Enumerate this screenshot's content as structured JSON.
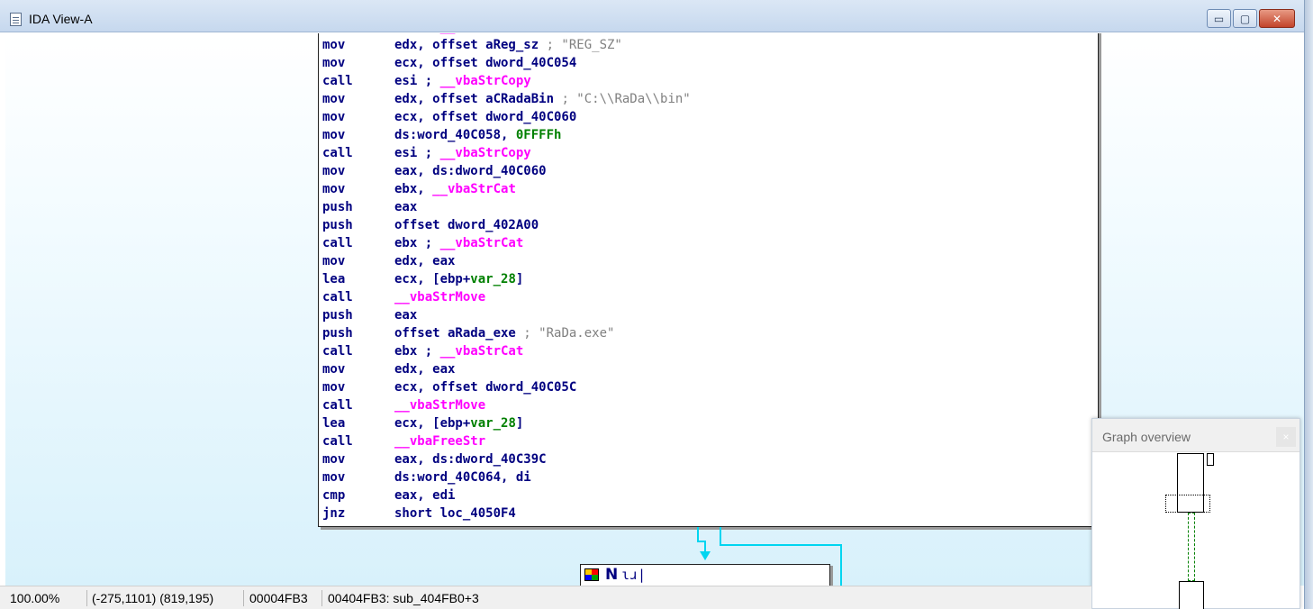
{
  "window": {
    "title": "IDA View-A",
    "buttons": {
      "minimize": "▭",
      "maximize": "▢",
      "close": "✕"
    }
  },
  "code": {
    "lines": [
      {
        "mn": "call",
        "parts": [
          [
            "r",
            "esi ; "
          ],
          [
            "k",
            "__vbaStrCopy"
          ]
        ]
      },
      {
        "mn": "mov",
        "parts": [
          [
            "r",
            "edx, offset aReg_sz "
          ],
          [
            "c",
            "; \"REG_SZ\""
          ]
        ]
      },
      {
        "mn": "mov",
        "parts": [
          [
            "r",
            "ecx, offset dword_40C054"
          ]
        ]
      },
      {
        "mn": "call",
        "parts": [
          [
            "r",
            "esi ; "
          ],
          [
            "k",
            "__vbaStrCopy"
          ]
        ]
      },
      {
        "mn": "mov",
        "parts": [
          [
            "r",
            "edx, offset aCRadaBin "
          ],
          [
            "c",
            "; \"C:\\\\RaDa\\\\bin\""
          ]
        ]
      },
      {
        "mn": "mov",
        "parts": [
          [
            "r",
            "ecx, offset dword_40C060"
          ]
        ]
      },
      {
        "mn": "mov",
        "parts": [
          [
            "r",
            "ds:word_40C058, "
          ],
          [
            "n",
            "0FFFFh"
          ]
        ]
      },
      {
        "mn": "call",
        "parts": [
          [
            "r",
            "esi ; "
          ],
          [
            "k",
            "__vbaStrCopy"
          ]
        ]
      },
      {
        "mn": "mov",
        "parts": [
          [
            "r",
            "eax, ds:dword_40C060"
          ]
        ]
      },
      {
        "mn": "mov",
        "parts": [
          [
            "r",
            "ebx, "
          ],
          [
            "k",
            "__vbaStrCat"
          ]
        ]
      },
      {
        "mn": "push",
        "parts": [
          [
            "r",
            "eax"
          ]
        ]
      },
      {
        "mn": "push",
        "parts": [
          [
            "r",
            "offset dword_402A00"
          ]
        ]
      },
      {
        "mn": "call",
        "parts": [
          [
            "r",
            "ebx ; "
          ],
          [
            "k",
            "__vbaStrCat"
          ]
        ]
      },
      {
        "mn": "mov",
        "parts": [
          [
            "r",
            "edx, eax"
          ]
        ]
      },
      {
        "mn": "lea",
        "parts": [
          [
            "r",
            "ecx, [ebp+"
          ],
          [
            "n",
            "var_28"
          ],
          [
            "r",
            "]"
          ]
        ]
      },
      {
        "mn": "call",
        "parts": [
          [
            "k",
            "__vbaStrMove"
          ]
        ]
      },
      {
        "mn": "push",
        "parts": [
          [
            "r",
            "eax"
          ]
        ]
      },
      {
        "mn": "push",
        "parts": [
          [
            "r",
            "offset aRada_exe "
          ],
          [
            "c",
            "; \"RaDa.exe\""
          ]
        ]
      },
      {
        "mn": "call",
        "parts": [
          [
            "r",
            "ebx ; "
          ],
          [
            "k",
            "__vbaStrCat"
          ]
        ]
      },
      {
        "mn": "mov",
        "parts": [
          [
            "r",
            "edx, eax"
          ]
        ]
      },
      {
        "mn": "mov",
        "parts": [
          [
            "r",
            "ecx, offset dword_40C05C"
          ]
        ]
      },
      {
        "mn": "call",
        "parts": [
          [
            "k",
            "__vbaStrMove"
          ]
        ]
      },
      {
        "mn": "lea",
        "parts": [
          [
            "r",
            "ecx, [ebp+"
          ],
          [
            "n",
            "var_28"
          ],
          [
            "r",
            "]"
          ]
        ]
      },
      {
        "mn": "call",
        "parts": [
          [
            "k",
            "__vbaFreeStr"
          ]
        ]
      },
      {
        "mn": "mov",
        "parts": [
          [
            "r",
            "eax, ds:dword_40C39C"
          ]
        ]
      },
      {
        "mn": "mov",
        "parts": [
          [
            "r",
            "ds:word_40C064, di"
          ]
        ]
      },
      {
        "mn": "cmp",
        "parts": [
          [
            "r",
            "eax, edi"
          ]
        ]
      },
      {
        "mn": "jnz",
        "parts": [
          [
            "r",
            "short loc_4050F4"
          ]
        ]
      }
    ]
  },
  "node2": {
    "n": "N",
    "u": "ɩɹ|"
  },
  "overview": {
    "title": "Graph overview",
    "close": "×"
  },
  "status": {
    "zoom": "100.00%",
    "coords": "(-275,1101) (819,195)",
    "offset": "00004FB3",
    "location": "00404FB3: sub_404FB0+3"
  }
}
